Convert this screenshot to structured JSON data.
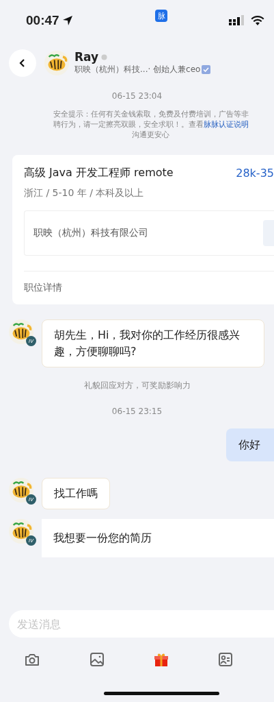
{
  "status_bar": {
    "time": "00:47",
    "app_badge": "脉"
  },
  "header": {
    "name": "Ray",
    "subtitle": "职映（杭州）科技...· 创始人兼ceo",
    "verified": true
  },
  "messages": [
    {
      "kind": "timestamp",
      "text": "06-15 23:04"
    },
    {
      "kind": "notice",
      "line_1": "安全提示：任何有关金钱索取，免费及付费培训，广告等非",
      "line_2": "聘行为，请一定擦亮双眼，安全求职！。查看",
      "link": "脉脉认证说明",
      "line_3": "沟通更安心"
    },
    {
      "kind": "job_card",
      "title": "高级 Java 开发工程师 remote",
      "salary": "28k-35",
      "meta": "浙江 / 5-10 年 / 本科及以上",
      "company": "职映（杭州）科技有限公司",
      "details_link": "职位详情"
    },
    {
      "kind": "incoming",
      "text": "胡先生，Hi，我对你的工作经历很感兴趣，方便聊聊吗?",
      "level_badge": "IV"
    },
    {
      "kind": "system",
      "text": "礼貌回应对方，可奖励影响力"
    },
    {
      "kind": "timestamp",
      "text": "06-15 23:15"
    },
    {
      "kind": "outgoing",
      "text": "你好"
    },
    {
      "kind": "incoming",
      "text": "找工作嗎",
      "level_badge": "IV"
    },
    {
      "kind": "incoming_wide",
      "text": "我想要一份您的简历",
      "level_badge": "IV"
    }
  ],
  "composer": {
    "placeholder": "发送消息"
  }
}
